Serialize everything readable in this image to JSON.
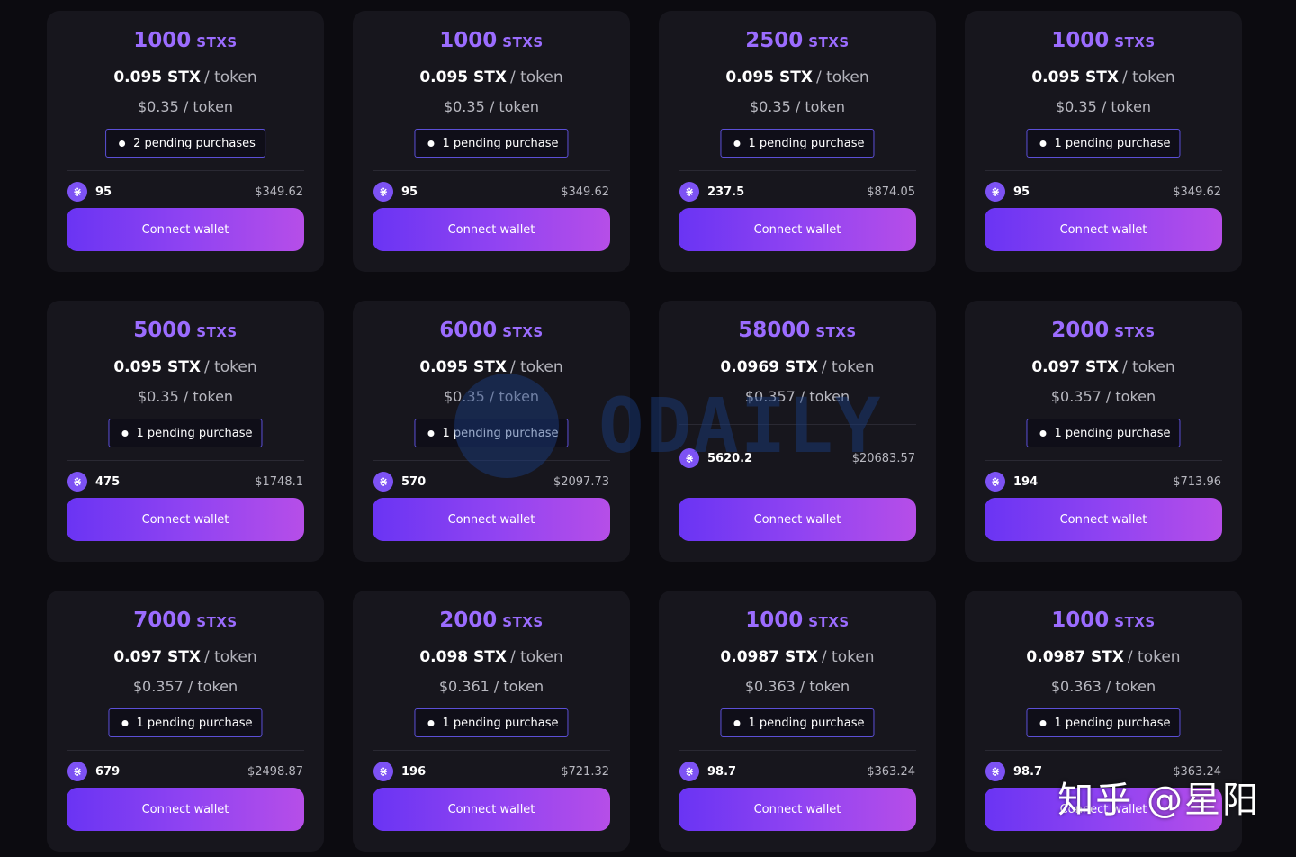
{
  "unit_label": "STXS",
  "per_token": "/ token",
  "icon_glyph": "⋇",
  "button_label": "Connect wallet",
  "watermark": {
    "brand": "ODAILY"
  },
  "attribution": "知乎 @星阳",
  "listings": [
    {
      "amount": "1000",
      "price": "0.095 STX",
      "usd": "$0.35",
      "pending": "2 pending purchases",
      "qty": "95",
      "total": "$349.62"
    },
    {
      "amount": "1000",
      "price": "0.095 STX",
      "usd": "$0.35",
      "pending": "1 pending purchase",
      "qty": "95",
      "total": "$349.62"
    },
    {
      "amount": "2500",
      "price": "0.095 STX",
      "usd": "$0.35",
      "pending": "1 pending purchase",
      "qty": "237.5",
      "total": "$874.05"
    },
    {
      "amount": "1000",
      "price": "0.095 STX",
      "usd": "$0.35",
      "pending": "1 pending purchase",
      "qty": "95",
      "total": "$349.62"
    },
    {
      "amount": "5000",
      "price": "0.095 STX",
      "usd": "$0.35",
      "pending": "1 pending purchase",
      "qty": "475",
      "total": "$1748.1"
    },
    {
      "amount": "6000",
      "price": "0.095 STX",
      "usd": "$0.35",
      "pending": "1 pending purchase",
      "qty": "570",
      "total": "$2097.73"
    },
    {
      "amount": "58000",
      "price": "0.0969 STX",
      "usd": "$0.357",
      "pending": "",
      "qty": "5620.2",
      "total": "$20683.57"
    },
    {
      "amount": "2000",
      "price": "0.097 STX",
      "usd": "$0.357",
      "pending": "1 pending purchase",
      "qty": "194",
      "total": "$713.96"
    },
    {
      "amount": "7000",
      "price": "0.097 STX",
      "usd": "$0.357",
      "pending": "1 pending purchase",
      "qty": "679",
      "total": "$2498.87"
    },
    {
      "amount": "2000",
      "price": "0.098 STX",
      "usd": "$0.361",
      "pending": "1 pending purchase",
      "qty": "196",
      "total": "$721.32"
    },
    {
      "amount": "1000",
      "price": "0.0987 STX",
      "usd": "$0.363",
      "pending": "1 pending purchase",
      "qty": "98.7",
      "total": "$363.24"
    },
    {
      "amount": "1000",
      "price": "0.0987 STX",
      "usd": "$0.363",
      "pending": "1 pending purchase",
      "qty": "98.7",
      "total": "$363.24"
    }
  ]
}
